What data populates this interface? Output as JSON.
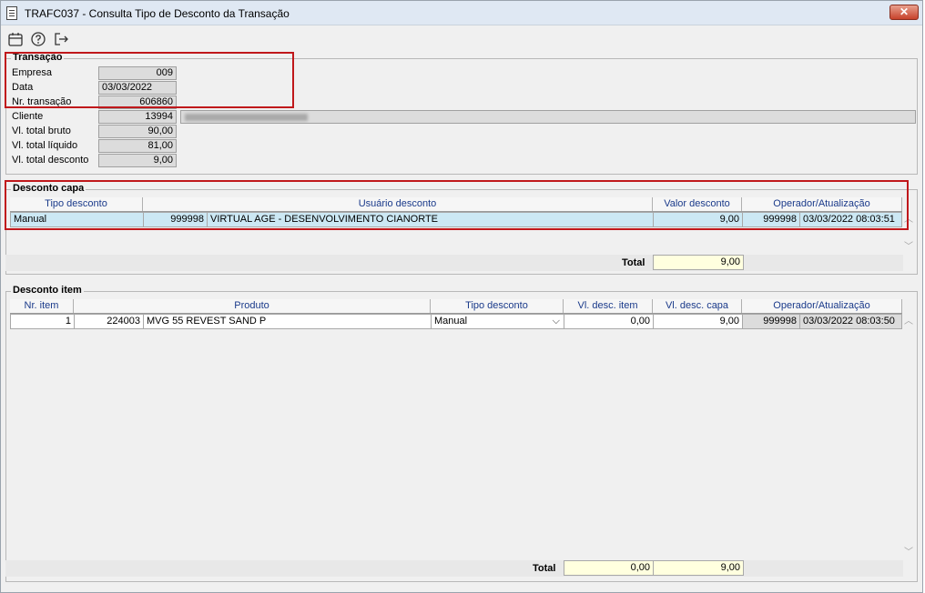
{
  "window": {
    "title": "TRAFC037 - Consulta Tipo de Desconto da Transação",
    "close_label": "✕"
  },
  "toolbar": {
    "icons": [
      "calendar-icon",
      "help-icon",
      "exit-icon"
    ]
  },
  "transacao": {
    "title": "Transação",
    "empresa_label": "Empresa",
    "empresa": "009",
    "data_label": "Data",
    "data": "03/03/2022",
    "nr_label": "Nr. transação",
    "nr": "606860",
    "cliente_label": "Cliente",
    "cliente": "13994",
    "bruto_label": "Vl. total bruto",
    "bruto": "90,00",
    "liquido_label": "Vl. total líquido",
    "liquido": "81,00",
    "desconto_label": "Vl. total desconto",
    "desconto": "9,00"
  },
  "capa": {
    "title": "Desconto capa",
    "columns": [
      "Tipo desconto",
      "Usuário desconto",
      "Valor desconto",
      "Operador/Atualização"
    ],
    "row": {
      "tipo": "Manual",
      "usuario_cod": "999998",
      "usuario_nome": "VIRTUAL AGE - DESENVOLVIMENTO CIANORTE",
      "valor": "9,00",
      "operador": "999998",
      "atualizacao": "03/03/2022 08:03:51"
    },
    "total_label": "Total",
    "total": "9,00"
  },
  "item": {
    "title": "Desconto item",
    "columns": [
      "Nr. item",
      "Produto",
      "Tipo desconto",
      "Vl. desc. item",
      "Vl. desc. capa",
      "Operador/Atualização"
    ],
    "row": {
      "nr": "1",
      "produto_cod": "224003",
      "produto_nome": "MVG 55 REVEST SAND P",
      "tipo": "Manual",
      "desc_item": "0,00",
      "desc_capa": "9,00",
      "operador": "999998",
      "atualizacao": "03/03/2022 08:03:50"
    },
    "total_label": "Total",
    "total_item": "0,00",
    "total_capa": "9,00"
  },
  "colors": {
    "highlight": "#c0181b",
    "selected_row": "#cce8f4",
    "total_bg": "#ffffdf",
    "header_text": "#1a3a8a"
  }
}
